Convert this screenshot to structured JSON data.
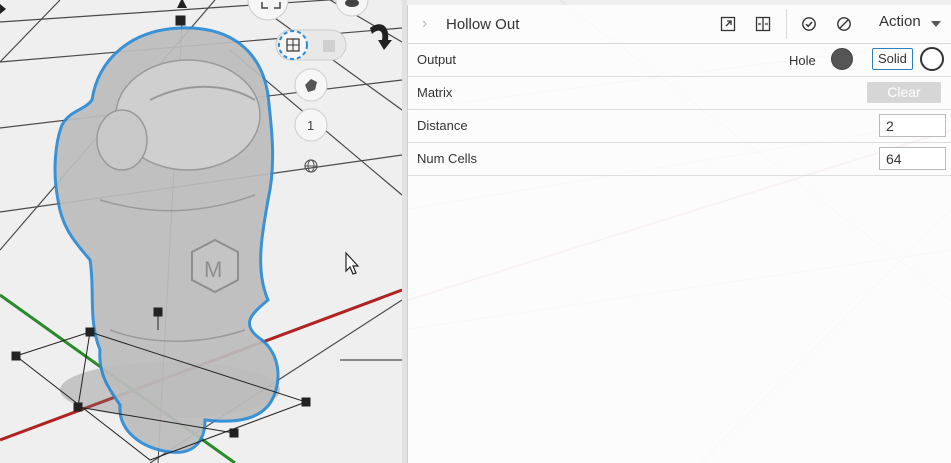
{
  "panel": {
    "title": "Hollow Out",
    "action_label": "Action"
  },
  "rows": {
    "output": {
      "label": "Output",
      "hole_label": "Hole",
      "solid_label": "Solid"
    },
    "matrix": {
      "label": "Matrix",
      "clear_label": "Clear"
    },
    "distance": {
      "label": "Distance",
      "value": "2"
    },
    "num_cells": {
      "label": "Num Cells",
      "value": "64"
    }
  },
  "toolbar": {
    "step_label": "1"
  },
  "colors": {
    "selection_outline": "#2a8ad4",
    "axis_x": "#c62828",
    "axis_y": "#2e9a2e",
    "clear_disabled": "#d6d6d6"
  }
}
